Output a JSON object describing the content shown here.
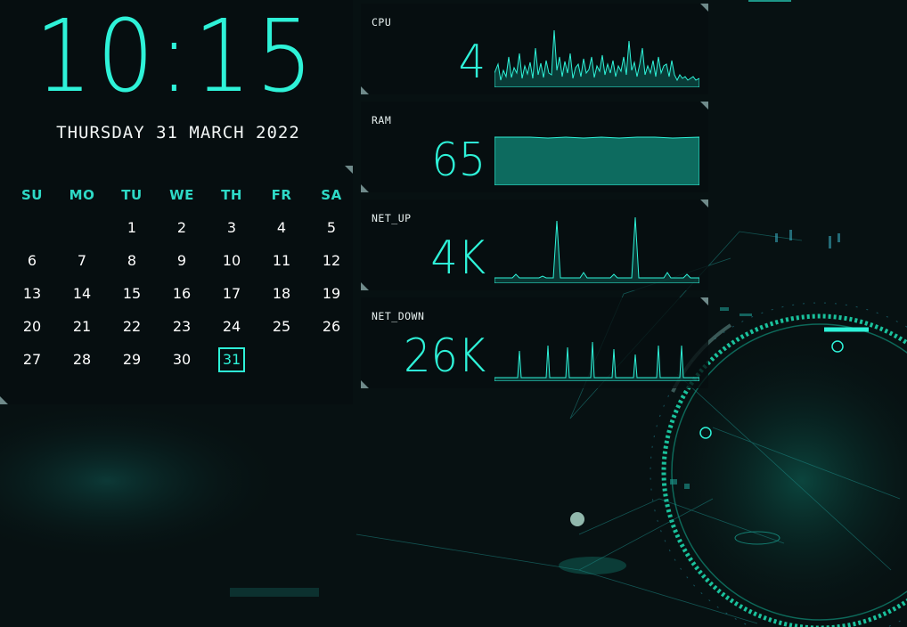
{
  "clock": {
    "time": "10:15",
    "date": "THURSDAY 31 MARCH 2022"
  },
  "calendar": {
    "weekdays": [
      "SU",
      "MO",
      "TU",
      "WE",
      "TH",
      "FR",
      "SA"
    ],
    "weeks": [
      [
        "",
        "",
        "1",
        "2",
        "3",
        "4",
        "5"
      ],
      [
        "6",
        "7",
        "8",
        "9",
        "10",
        "11",
        "12"
      ],
      [
        "13",
        "14",
        "15",
        "16",
        "17",
        "18",
        "19"
      ],
      [
        "20",
        "21",
        "22",
        "23",
        "24",
        "25",
        "26"
      ],
      [
        "27",
        "28",
        "29",
        "30",
        "31",
        "",
        ""
      ]
    ],
    "today": "31"
  },
  "monitors": [
    {
      "label": "CPU",
      "value": "4"
    },
    {
      "label": "RAM",
      "value": "65"
    },
    {
      "label": "NET_UP",
      "value": "4K"
    },
    {
      "label": "NET_DOWN",
      "value": "26K"
    }
  ],
  "colors": {
    "accent": "#2ef2d8",
    "background": "#071112",
    "text": "#ffffff"
  }
}
